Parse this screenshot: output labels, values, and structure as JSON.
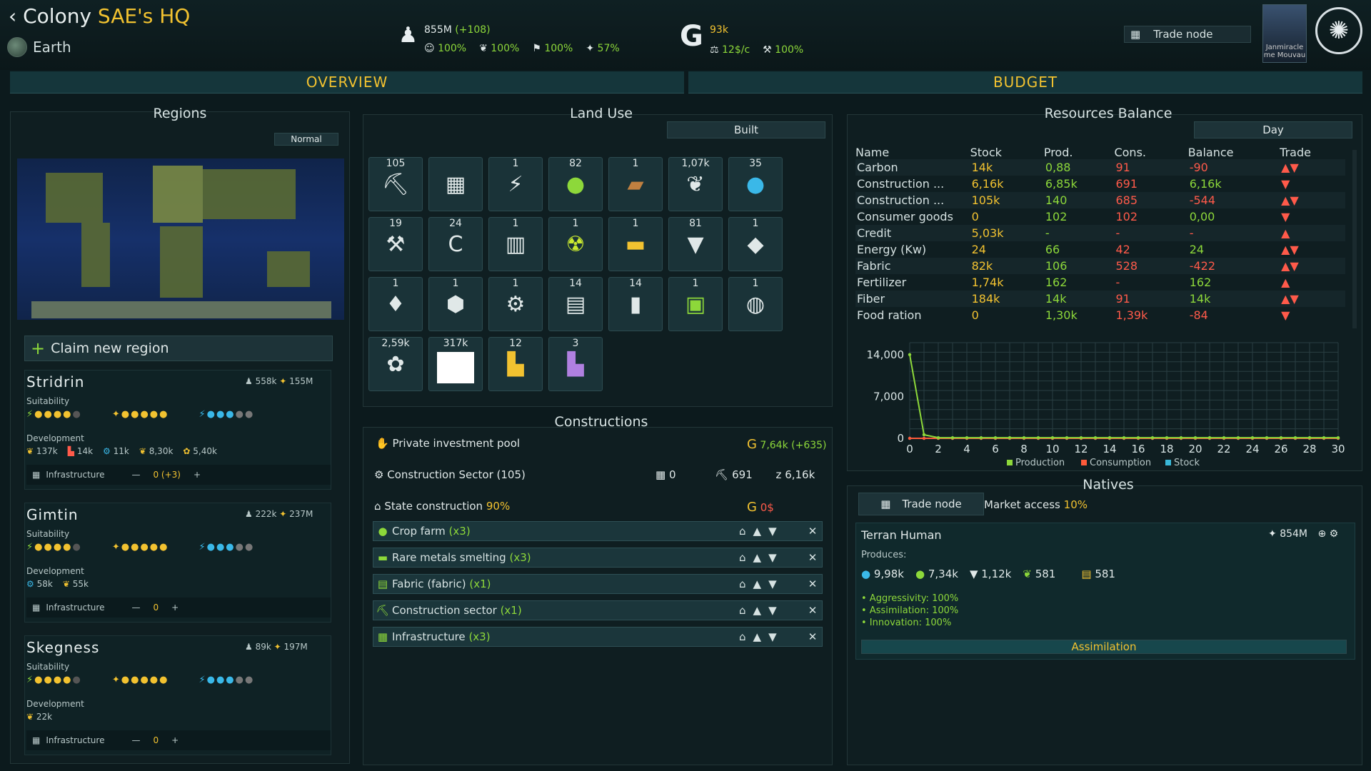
{
  "header": {
    "title_prefix": "Colony ",
    "title_highlight": "SAE's HQ",
    "planet": "Earth",
    "population": "855M",
    "population_delta": "(+108)",
    "happiness": "100%",
    "food": "100%",
    "goods": "100%",
    "approval": "57%",
    "credits": "93k",
    "income": "12$/c",
    "efficiency": "100%",
    "trade_node": "Trade node",
    "avatar_name": "Janmiracle me Mouvau"
  },
  "tabs": {
    "overview": "OVERVIEW",
    "budget": "BUDGET"
  },
  "regions": {
    "title": "Regions",
    "map_mode": "Normal",
    "claim": "Claim new region",
    "suitability_label": "Suitability",
    "development_label": "Development",
    "infrastructure_label": "Infrastructure",
    "items": [
      {
        "name": "Stridrin",
        "pop": "558k",
        "workers": "155M",
        "dev": [
          "137k",
          "14k",
          "11k",
          "8,30k",
          "5,40k"
        ],
        "infra": "0 (+3)"
      },
      {
        "name": "Gimtin",
        "pop": "222k",
        "workers": "237M",
        "dev": [
          "58k",
          "55k"
        ],
        "infra": "0"
      },
      {
        "name": "Skegness",
        "pop": "89k",
        "workers": "197M",
        "dev": [
          "22k"
        ],
        "infra": "0"
      }
    ]
  },
  "land_use": {
    "title": "Land Use",
    "filter": "Built",
    "tiles": [
      {
        "n": "105",
        "icon": "crane-icon",
        "g": "⛏"
      },
      {
        "n": "",
        "icon": "fence-icon",
        "g": "▦"
      },
      {
        "n": "1",
        "icon": "wind-solar-icon",
        "g": "⚡"
      },
      {
        "n": "82",
        "icon": "apple-icon",
        "g": "●"
      },
      {
        "n": "1",
        "icon": "wood-icon",
        "g": "▰"
      },
      {
        "n": "1,07k",
        "icon": "leaf-icon",
        "g": "❦"
      },
      {
        "n": "35",
        "icon": "water-drop-icon",
        "g": "●"
      },
      {
        "n": "19",
        "icon": "mining-icon",
        "g": "⚒"
      },
      {
        "n": "24",
        "icon": "carbon-icon",
        "g": "C"
      },
      {
        "n": "1",
        "icon": "rail-icon",
        "g": "▥"
      },
      {
        "n": "1",
        "icon": "radiation-icon",
        "g": "☢"
      },
      {
        "n": "1",
        "icon": "ingot-icon",
        "g": "▬"
      },
      {
        "n": "81",
        "icon": "basket-icon",
        "g": "▼"
      },
      {
        "n": "1",
        "icon": "layers-icon",
        "g": "◆"
      },
      {
        "n": "1",
        "icon": "robot-icon",
        "g": "♦"
      },
      {
        "n": "1",
        "icon": "hexagon-icon",
        "g": "⬢"
      },
      {
        "n": "1",
        "icon": "gear-icon",
        "g": "⚙"
      },
      {
        "n": "14",
        "icon": "fabric-icon",
        "g": "▤"
      },
      {
        "n": "14",
        "icon": "bottle-icon",
        "g": "▮"
      },
      {
        "n": "1",
        "icon": "chip-icon",
        "g": "▣"
      },
      {
        "n": "1",
        "icon": "dome-icon",
        "g": "◍"
      },
      {
        "n": "2,59k",
        "icon": "goods-icon",
        "g": "✿"
      },
      {
        "n": "317k",
        "icon": "blank-icon",
        "g": ""
      },
      {
        "n": "12",
        "icon": "factory-icon",
        "g": "▙"
      },
      {
        "n": "3",
        "icon": "factory-purple-icon",
        "g": "▙"
      }
    ]
  },
  "constructions": {
    "title": "Constructions",
    "pool_label": "Private investment pool",
    "pool_value": "7,64k (+635)",
    "sector_label": "Construction Sector (105)",
    "sector_a": "0",
    "sector_b": "691",
    "sector_c": "6,16k",
    "state_label": "State construction",
    "state_pct": "90%",
    "state_value": "0$",
    "queue": [
      {
        "name": "Crop farm",
        "count": "(x3)",
        "icon": "apple-icon",
        "g": "●"
      },
      {
        "name": "Rare metals smelting",
        "count": "(x3)",
        "icon": "ingot-icon",
        "g": "▬"
      },
      {
        "name": "Fabric (fabric)",
        "count": "(x1)",
        "icon": "fabric-icon",
        "g": "▤"
      },
      {
        "name": "Construction sector",
        "count": "(x1)",
        "icon": "crane-icon",
        "g": "⛏"
      },
      {
        "name": "Infrastructure",
        "count": "(x3)",
        "icon": "fence-icon",
        "g": "▦"
      }
    ]
  },
  "resources": {
    "title": "Resources Balance",
    "period": "Day",
    "headers": [
      "Name",
      "Stock",
      "Prod.",
      "Cons.",
      "Balance",
      "Trade"
    ],
    "rows": [
      [
        "Carbon",
        "14k",
        "0,88",
        "91",
        "-90",
        "▲▼"
      ],
      [
        "Construction ...",
        "6,16k",
        "6,85k",
        "691",
        "6,16k",
        "▼"
      ],
      [
        "Construction ...",
        "105k",
        "140",
        "685",
        "-544",
        "▲▼"
      ],
      [
        "Consumer goods",
        "0",
        "102",
        "102",
        "0,00",
        "▼"
      ],
      [
        "Credit",
        "5,03k",
        "-",
        "-",
        "-",
        "▲"
      ],
      [
        "Energy (Kw)",
        "24",
        "66",
        "42",
        "24",
        "▲▼"
      ],
      [
        "Fabric",
        "82k",
        "106",
        "528",
        "-422",
        "▲▼"
      ],
      [
        "Fertilizer",
        "1,74k",
        "162",
        "-",
        "162",
        "▲"
      ],
      [
        "Fiber",
        "184k",
        "14k",
        "91",
        "14k",
        "▲▼"
      ],
      [
        "Food ration",
        "0",
        "1,30k",
        "1,39k",
        "-84",
        "▼"
      ]
    ]
  },
  "chart_data": {
    "type": "line",
    "x": [
      0,
      1,
      2,
      3,
      4,
      5,
      6,
      7,
      8,
      9,
      10,
      11,
      12,
      13,
      14,
      15,
      16,
      17,
      18,
      19,
      20,
      21,
      22,
      23,
      24,
      25,
      26,
      27,
      28,
      29,
      30
    ],
    "xticks": [
      "0",
      "2",
      "4",
      "6",
      "8",
      "10",
      "12",
      "14",
      "16",
      "18",
      "20",
      "22",
      "24",
      "26",
      "28",
      "30"
    ],
    "yticks": [
      "0",
      "7,000",
      "14,000"
    ],
    "ylim": [
      0,
      16000
    ],
    "series": [
      {
        "name": "Production",
        "color": "#8dd83a",
        "values": [
          14000,
          600,
          100,
          100,
          100,
          100,
          100,
          100,
          100,
          100,
          100,
          100,
          100,
          100,
          100,
          100,
          100,
          100,
          100,
          100,
          100,
          100,
          100,
          100,
          100,
          100,
          100,
          100,
          100,
          100,
          100
        ]
      },
      {
        "name": "Consumption",
        "color": "#ff5a3a",
        "values": [
          0,
          0,
          0,
          0,
          0,
          0,
          0,
          0,
          0,
          0,
          0,
          0,
          0,
          0,
          0,
          0,
          0,
          0,
          0,
          0,
          0,
          0,
          0,
          0,
          0,
          0,
          0,
          0,
          0,
          0,
          0
        ]
      },
      {
        "name": "Stock",
        "color": "#3ab8d8",
        "values": [
          0,
          0,
          0,
          0,
          0,
          0,
          0,
          0,
          0,
          0,
          0,
          0,
          0,
          0,
          0,
          0,
          0,
          0,
          0,
          0,
          0,
          0,
          0,
          0,
          0,
          0,
          0,
          0,
          0,
          0,
          0
        ]
      }
    ]
  },
  "natives": {
    "title": "Natives",
    "trade_node": "Trade node",
    "market_label": "Market access",
    "market_value": "10%",
    "race": "Terran Human",
    "race_pop": "854M",
    "produces_label": "Produces:",
    "produces": [
      "9,98k",
      "7,34k",
      "1,12k",
      "581",
      "581"
    ],
    "traits": [
      "• Aggressivity: 100%",
      "• Assimilation: 100%",
      "• Innovation: 100%"
    ],
    "assimilation": "Assimilation"
  }
}
